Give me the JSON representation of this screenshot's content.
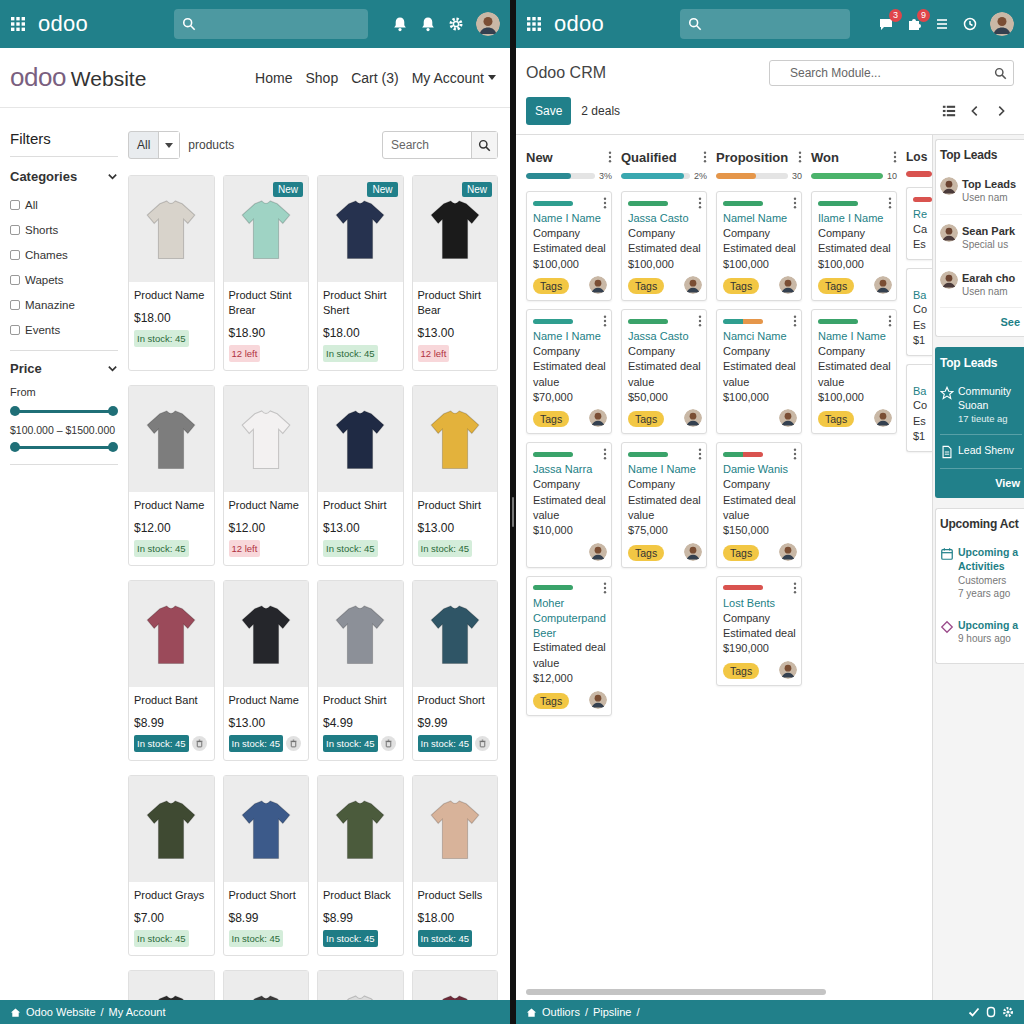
{
  "left": {
    "topbar": {
      "logo": "odoo"
    },
    "site": {
      "brand": "odoo",
      "name": "Website",
      "nav": [
        {
          "label": "Home",
          "dropdown": false
        },
        {
          "label": "Shop",
          "dropdown": false
        },
        {
          "label": "Cart (3)",
          "dropdown": false
        },
        {
          "label": "My Account",
          "dropdown": true
        }
      ]
    },
    "filters": {
      "title": "Filters",
      "categories": {
        "title": "Categories",
        "expanded": true,
        "items": [
          {
            "label": "All",
            "checked": false
          },
          {
            "label": "Shorts",
            "checked": false
          },
          {
            "label": "Chames",
            "checked": false
          },
          {
            "label": "Wapets",
            "checked": false
          },
          {
            "label": "Manazine",
            "checked": false
          },
          {
            "label": "Events",
            "checked": false
          }
        ]
      },
      "price": {
        "title": "Price",
        "expanded": true,
        "from_label": "From",
        "range": "$100.000 – $1500.000",
        "sliders": [
          {
            "low": 0,
            "high": 1
          },
          {
            "low": 0,
            "high": 1
          }
        ]
      }
    },
    "toolbar": {
      "scope": "All",
      "label": "products",
      "search": {
        "placeholder": "Search"
      }
    },
    "products": [
      {
        "name": "Product Name",
        "price": "$18.00",
        "stock": "In stock: 45",
        "kind": "stock",
        "color": "#d8d3cb",
        "removable": false
      },
      {
        "name": "Product Stint Brear",
        "price": "$18.90",
        "stock": "12 left",
        "kind": "low",
        "color": "#9fd3c4",
        "removable": false,
        "badge": "New"
      },
      {
        "name": "Product Shirt Shert",
        "price": "$18.00",
        "stock": "In stock: 45",
        "kind": "stock",
        "color": "#26324f",
        "removable": false,
        "badge": "New"
      },
      {
        "name": "Product Shirt Bear",
        "price": "$13.00",
        "stock": "12 left",
        "kind": "low",
        "color": "#1b1b1b",
        "removable": false,
        "badge": "New"
      },
      {
        "name": "Product Name",
        "price": "$12.00",
        "stock": "In stock: 45",
        "kind": "stock",
        "color": "#7d7d7d",
        "removable": false
      },
      {
        "name": "Product Name",
        "price": "$12.00",
        "stock": "12 left",
        "kind": "low",
        "color": "#f3f1f1",
        "removable": false
      },
      {
        "name": "Product Shirt",
        "price": "$13.00",
        "stock": "In stock: 45",
        "kind": "stock",
        "color": "#1f2a44",
        "removable": false
      },
      {
        "name": "Product Shirt",
        "price": "$13.00",
        "stock": "In stock: 45",
        "kind": "stock",
        "color": "#e3b23c",
        "removable": false
      },
      {
        "name": "Product Bant",
        "price": "$8.99",
        "stock": "In stock: 45",
        "kind": "solid",
        "color": "#9b4a5a",
        "removable": true
      },
      {
        "name": "Product Name",
        "price": "$13.00",
        "stock": "In stock: 45",
        "kind": "solid",
        "color": "#25262b",
        "removable": true
      },
      {
        "name": "Product Shirt",
        "price": "$4.99",
        "stock": "In stock: 45",
        "kind": "solid",
        "color": "#8c9098",
        "removable": true
      },
      {
        "name": "Product Short",
        "price": "$9.99",
        "stock": "In stock: 45",
        "kind": "solid",
        "color": "#2f5566",
        "removable": true
      },
      {
        "name": "Product Grays",
        "price": "$7.00",
        "stock": "In stock: 45",
        "kind": "stock",
        "color": "#3f4a32",
        "removable": false
      },
      {
        "name": "Product Short",
        "price": "$8.99",
        "stock": "In stock: 45",
        "kind": "stock",
        "color": "#3c5a8a",
        "removable": false
      },
      {
        "name": "Product Black",
        "price": "$8.99",
        "stock": "In stock: 45",
        "kind": "solid",
        "color": "#4b5b3c",
        "removable": false
      },
      {
        "name": "Product Sells",
        "price": "$18.00",
        "stock": "In stock: 45",
        "kind": "solid",
        "color": "#d8b39a",
        "removable": false
      }
    ],
    "clipped_images": [
      "#2a2a2a",
      "#3a3a3a",
      "#dcdcdc",
      "#6e2b3a"
    ],
    "status_bar": {
      "crumbs": [
        "Odoo Website",
        "My Account"
      ],
      "separator": "/",
      "trailing": false
    }
  },
  "right": {
    "topbar": {
      "logo": "odoo",
      "badges": [
        "3",
        "9"
      ]
    },
    "header": {
      "title": "Odoo CRM",
      "search": {
        "placeholder": "Search Module..."
      },
      "save": "Save",
      "count": "2 deals"
    },
    "columns": [
      {
        "title": "New",
        "clipped": false,
        "progress": {
          "level": 0.65,
          "color": "#2b8a93",
          "reading": "3%"
        },
        "cards": [
          {
            "name": "Name I Name",
            "company": "Company",
            "deal_label": "Estimated deal",
            "value": "$100,000",
            "tag": "Tags",
            "bars": [
              "#2f9e8f"
            ]
          },
          {
            "name": "Name I Name",
            "company": "Company",
            "deal_label": "Estimated deal value",
            "value": "$70,000",
            "tag": "Tags",
            "bars": [
              "#2f9e8f"
            ]
          },
          {
            "name": "Jassa Narra",
            "company": "Company",
            "deal_label": "Estimated deal value",
            "value": "$10,000",
            "bars": [
              "#3aa36a"
            ]
          },
          {
            "name": "Moher Computerpand Beer",
            "deal_label": "Estimated deal value",
            "value": "$12,000",
            "tag": "Tags",
            "bars": [
              "#3aa36a"
            ]
          }
        ]
      },
      {
        "title": "Qualified",
        "clipped": false,
        "progress": {
          "level": 0.92,
          "color": "#3aa8b0",
          "reading": "2%"
        },
        "cards": [
          {
            "name": "Jassa Casto",
            "company": "Company",
            "deal_label": "Estimated deal",
            "value": "$100,000",
            "tag": "Tags",
            "bars": [
              "#3aa36a"
            ]
          },
          {
            "name": "Jassa Casto",
            "company": "Company",
            "deal_label": "Estimated deal value",
            "value": "$50,000",
            "tag": "Tags",
            "bars": [
              "#3aa36a"
            ]
          },
          {
            "name": "Name I Name",
            "company": "Company",
            "deal_label": "Estimated deal value",
            "value": "$75,000",
            "tag": "Tags",
            "bars": [
              "#3aa36a"
            ]
          }
        ]
      },
      {
        "title": "Proposition",
        "clipped": false,
        "progress": {
          "level": 0.55,
          "color": "#e5964a",
          "reading": "30"
        },
        "cards": [
          {
            "name": "Namel Name",
            "company": "Company",
            "deal_label": "Estimated deal",
            "value": "$100,000",
            "tag": "Tags",
            "bars": [
              "#3aa36a"
            ]
          },
          {
            "name": "Namci Name",
            "company": "Company",
            "deal_label": "Estimated deal value",
            "value": "$100,000",
            "bars": [
              "#2f9e8f",
              "#e5964a"
            ]
          },
          {
            "name": "Damie Wanis",
            "company": "Company",
            "deal_label": "Estimated deal value",
            "value": "$150,000",
            "tag": "Tags",
            "bars": [
              "#3aa36a",
              "#d9534f"
            ]
          },
          {
            "name": "Lost Bents",
            "company": "Company",
            "deal_label": "Estimated deal",
            "value": "$190,000",
            "tag": "Tags",
            "bars": [
              "#d9534f"
            ]
          }
        ]
      },
      {
        "title": "Won",
        "clipped": false,
        "progress": {
          "level": 1,
          "color": "#4bb36b",
          "reading": "10"
        },
        "cards": [
          {
            "name": "Ilame I Name",
            "company": "Company",
            "deal_label": "Estimated deal",
            "value": "$100,000",
            "tag": "Tags",
            "bars": [
              "#3aa36a"
            ]
          },
          {
            "name": "Name I Name",
            "company": "Company",
            "deal_label": "Estimated deal value",
            "value": "$100,000",
            "tag": "Tags",
            "bars": [
              "#3aa36a"
            ]
          }
        ]
      },
      {
        "title": "Los",
        "clipped": true,
        "progress": {
          "level": 1,
          "color": "#d9534f"
        },
        "cards": [
          {
            "name": "Re",
            "company": "Ca",
            "deal_label": "Es",
            "bars": [
              "#d9534f"
            ]
          },
          {
            "name": "Ba",
            "company": "Co",
            "deal_label": "Es",
            "value": "$1",
            "bars": []
          },
          {
            "name": "Ba",
            "company": "Co",
            "deal_label": "Es",
            "value": "$1",
            "bars": []
          }
        ]
      }
    ],
    "panel": {
      "sections": [
        {
          "title": "Top Leads",
          "kind": "people",
          "link": "See",
          "items": [
            {
              "kind": "person",
              "title_lines": [
                "Top Leads"
              ],
              "sub_lines": [
                "Usen nam"
              ]
            },
            {
              "kind": "person",
              "title_lines": [
                "Sean Park"
              ],
              "sub_lines": [
                "Special us"
              ]
            },
            {
              "kind": "person",
              "title_lines": [
                "Earah cho"
              ],
              "sub_lines": [
                "Usen nam"
              ]
            }
          ]
        },
        {
          "title": "Top Leads",
          "kind": "highlight",
          "link": "View",
          "items": [
            {
              "kind": "star",
              "title_lines": [
                "Community",
                "Suoan"
              ],
              "sub_lines": [
                "17 tieute ag"
              ]
            },
            {
              "kind": "doc",
              "title_lines": [
                "Lead Shenv"
              ],
              "sub_lines": []
            }
          ]
        },
        {
          "title": "Upcoming Act",
          "kind": "list",
          "items": [
            {
              "kind": "calendar",
              "title_lines": [
                "Upcoming a",
                "Activities"
              ],
              "sub_lines": [
                "Customers",
                "7 years ago"
              ]
            },
            {
              "kind": "diamond",
              "title_lines": [
                "Upcoming a"
              ],
              "sub_lines": [
                "9 hours ago"
              ]
            }
          ]
        }
      ]
    },
    "status_bar": {
      "crumbs": [
        "Outliors",
        "Pipsline"
      ],
      "separator": "/",
      "trailing": true
    }
  }
}
